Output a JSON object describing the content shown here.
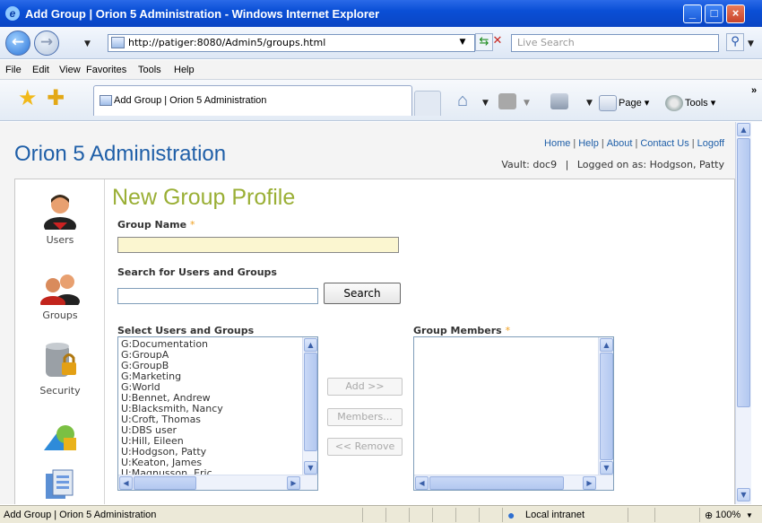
{
  "window": {
    "title": "Add Group | Orion 5 Administration - Windows Internet Explorer"
  },
  "address_bar": {
    "url": "http://patiger:8080/Admin5/groups.html",
    "search_placeholder": "Live Search"
  },
  "menu": {
    "items": [
      "File",
      "Edit",
      "View",
      "Favorites",
      "Tools",
      "Help"
    ]
  },
  "tab": {
    "label": "Add Group | Orion 5 Administration"
  },
  "command_bar": {
    "page_label": "Page",
    "tools_label": "Tools"
  },
  "header": {
    "app_title": "Orion 5 Administration",
    "links": [
      "Home",
      "Help",
      "About",
      "Contact Us",
      "Logoff"
    ],
    "vault": "Vault: doc9",
    "logged_on": "Logged on as: Hodgson, Patty"
  },
  "sidebar": {
    "items": [
      {
        "label": "Users",
        "icon": "users-icon"
      },
      {
        "label": "Groups",
        "icon": "groups-icon"
      },
      {
        "label": "Security",
        "icon": "security-icon"
      },
      {
        "label": "",
        "icon": "shapes-icon"
      },
      {
        "label": "",
        "icon": "reports-icon"
      }
    ]
  },
  "form": {
    "page_title": "New Group Profile",
    "group_name_label": "Group Name",
    "required_mark": "*",
    "group_name_value": "",
    "search_label": "Search for Users and Groups",
    "search_value": "",
    "search_button": "Search",
    "select_label": "Select Users and Groups",
    "members_label": "Group Members",
    "select_options": [
      "G:Documentation",
      "G:GroupA",
      "G:GroupB",
      "G:Marketing",
      "G:World",
      "U:Bennet, Andrew",
      "U:Blacksmith, Nancy",
      "U:Croft, Thomas",
      "U:DBS user",
      "U:Hill, Eileen",
      "U:Hodgson, Patty",
      "U:Keaton, James",
      "U:Magnusson, Eric"
    ],
    "members": [],
    "add_button": "Add >>",
    "members_button": "Members...",
    "remove_button": "<< Remove"
  },
  "status_bar": {
    "text": "Add Group | Orion 5 Administration",
    "zone": "Local intranet",
    "zoom": "100%"
  }
}
